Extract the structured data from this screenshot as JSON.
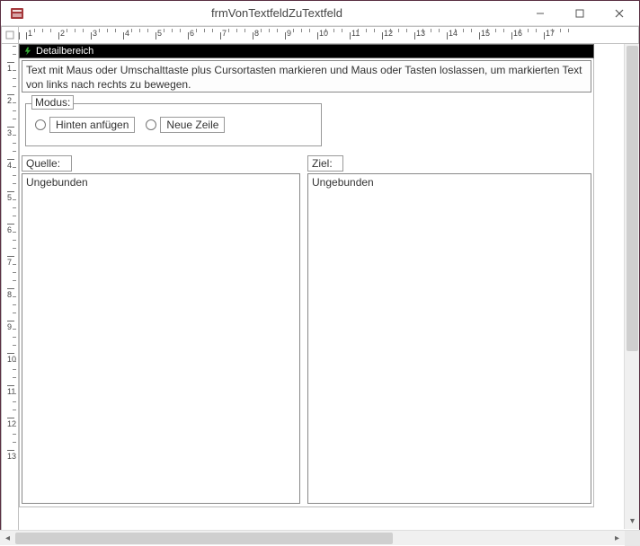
{
  "window": {
    "title": "frmVonTextfeldZuTextfeld"
  },
  "section": {
    "detail_label": "Detailbereich"
  },
  "instruction": "Text mit Maus oder Umschalttaste plus Cursortasten markieren und Maus oder Tasten loslassen, um markierten Text von links nach rechts zu bewegen.",
  "modus": {
    "group_label": "Modus:",
    "option_append": "Hinten anfügen",
    "option_newline": "Neue Zeile"
  },
  "fields": {
    "quelle_label": "Quelle:",
    "ziel_label": "Ziel:",
    "quelle_value": "Ungebunden",
    "ziel_value": "Ungebunden"
  },
  "ruler": {
    "h": [
      "1",
      "2",
      "3",
      "4",
      "5",
      "6",
      "7",
      "8",
      "9",
      "10",
      "11",
      "12",
      "13",
      "14",
      "15",
      "16",
      "17"
    ],
    "v": [
      "1",
      "2",
      "3",
      "4",
      "5",
      "6",
      "7",
      "8",
      "9",
      "10",
      "11",
      "12",
      "13"
    ]
  }
}
